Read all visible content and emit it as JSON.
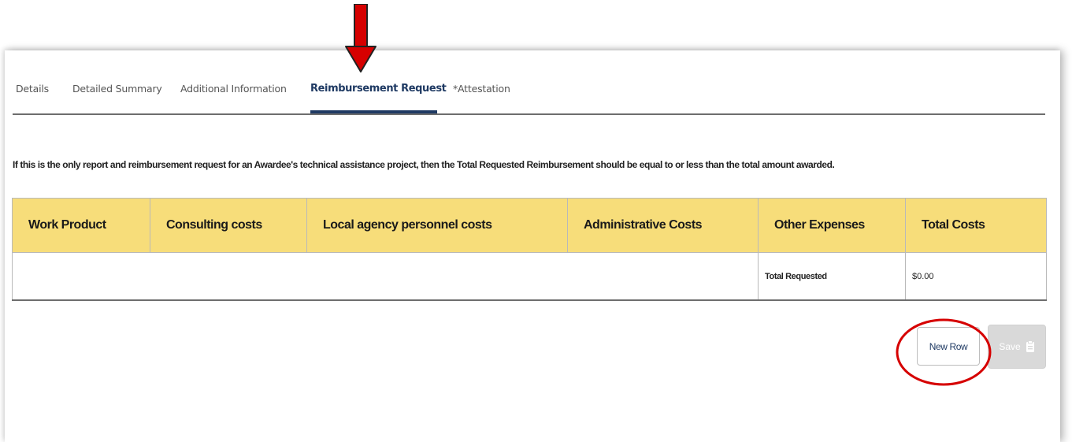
{
  "tabs": [
    {
      "label": "Details"
    },
    {
      "label": "Detailed Summary"
    },
    {
      "label": "Additional Information"
    },
    {
      "label": "Reimbursement Request",
      "active": true
    },
    {
      "label": "*Attestation"
    }
  ],
  "notice": "If this is the only report and reimbursement request for an Awardee's technical assistance project, then the Total Requested Reimbursement should be equal to or less than the total amount awarded.",
  "table": {
    "headers": [
      "Work Product",
      "Consulting costs",
      "Local agency personnel costs",
      "Administrative Costs",
      "Other Expenses",
      "Total Costs"
    ],
    "total_label": "Total Requested",
    "total_value": "$0.00"
  },
  "actions": {
    "new_row_label": "New Row",
    "save_label": "Save"
  },
  "icons": {
    "save": "clipboard-icon",
    "annotation_arrow": "down-arrow-icon",
    "annotation_circle": "highlight-circle-icon"
  },
  "colors": {
    "header_fill": "#f7dd7a",
    "active_tab": "#1f3a63",
    "annotation": "#d60000",
    "save_disabled": "#d9d9d9"
  }
}
